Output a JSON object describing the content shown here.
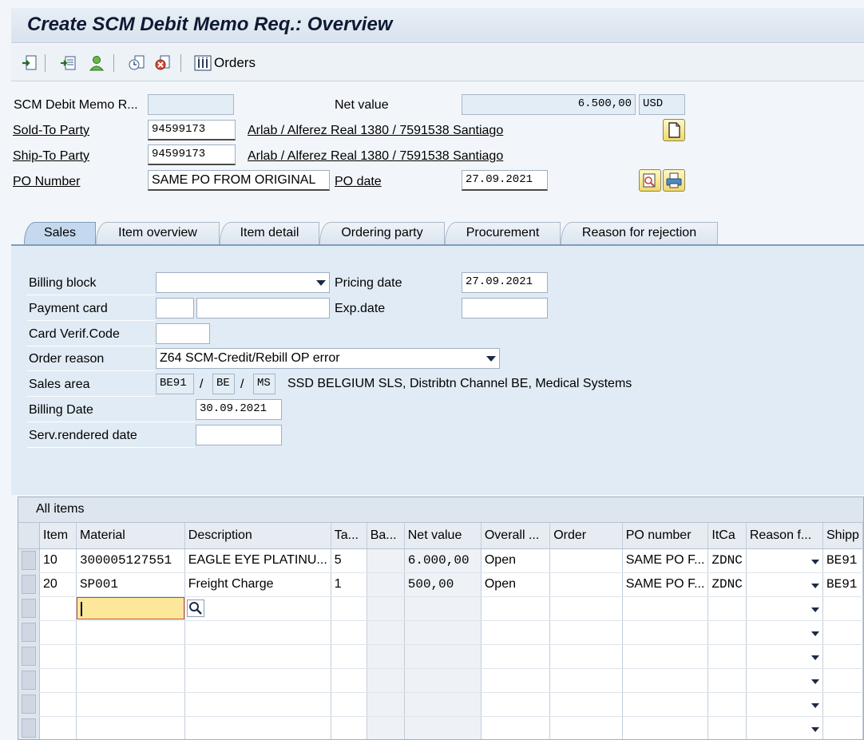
{
  "title": "Create SCM Debit Memo Req.: Overview",
  "toolbar": {
    "orders_label": "Orders",
    "icons": [
      "create-document-icon",
      "header-details-icon",
      "partner-person-icon",
      "document-flow-icon",
      "delete-icon",
      "orders-list-icon"
    ]
  },
  "header": {
    "memo_label": "SCM Debit Memo R...",
    "memo_value": "",
    "net_value_label": "Net value",
    "net_value": "6.500,00",
    "currency": "USD",
    "sold_to_label": "Sold-To Party",
    "sold_to_value": "94599173",
    "sold_to_address": "Arlab / Alferez Real 1380 / 7591538 Santiago",
    "ship_to_label": "Ship-To Party",
    "ship_to_value": "94599173",
    "ship_to_address": "Arlab / Alferez Real 1380 / 7591538 Santiago",
    "po_number_label": "PO Number",
    "po_number_value": "SAME PO FROM ORIGINAL",
    "po_date_label": "PO date",
    "po_date_value": "27.09.2021"
  },
  "tabs": [
    {
      "label": "Sales",
      "active": true
    },
    {
      "label": "Item overview"
    },
    {
      "label": "Item detail"
    },
    {
      "label": "Ordering party"
    },
    {
      "label": "Procurement"
    },
    {
      "label": "Reason for rejection"
    }
  ],
  "sales": {
    "billing_block_label": "Billing block",
    "billing_block_value": "",
    "pricing_date_label": "Pricing date",
    "pricing_date_value": "27.09.2021",
    "payment_card_label": "Payment card",
    "payment_card_type": "",
    "payment_card_number": "",
    "exp_date_label": "Exp.date",
    "exp_date_value": "",
    "card_verif_label": "Card Verif.Code",
    "card_verif_value": "",
    "order_reason_label": "Order reason",
    "order_reason_value": "Z64 SCM-Credit/Rebill OP error",
    "sales_area_label": "Sales area",
    "sales_org": "BE91",
    "distr_channel": "BE",
    "division": "MS",
    "slash": "/",
    "sales_area_text": "SSD BELGIUM SLS, Distribtn Channel BE, Medical Systems",
    "billing_date_label": "Billing Date",
    "billing_date_value": "30.09.2021",
    "serv_rendered_label": "Serv.rendered date",
    "serv_rendered_value": ""
  },
  "items": {
    "title": "All items",
    "columns": [
      "Item",
      "Material",
      "Description",
      "Ta...",
      "Ba...",
      "Net value",
      "Overall ...",
      "Order",
      "PO number",
      "ItCa",
      "Reason f...",
      "Shipp"
    ],
    "rows": [
      {
        "item": "10",
        "material": "300005127551",
        "description": "EAGLE EYE PLATINU...",
        "ta": "5",
        "ba": "",
        "net_value": "6.000,00",
        "overall": "Open",
        "order": "",
        "po_number": "SAME PO F...",
        "itca": "ZDNC",
        "reason": "",
        "shipp": "BE91"
      },
      {
        "item": "20",
        "material": "SP001",
        "description": "Freight Charge",
        "ta": "1",
        "ba": "",
        "net_value": "500,00",
        "overall": "Open",
        "order": "",
        "po_number": "SAME PO F...",
        "itca": "ZDNC",
        "reason": "",
        "shipp": "BE91"
      }
    ]
  }
}
